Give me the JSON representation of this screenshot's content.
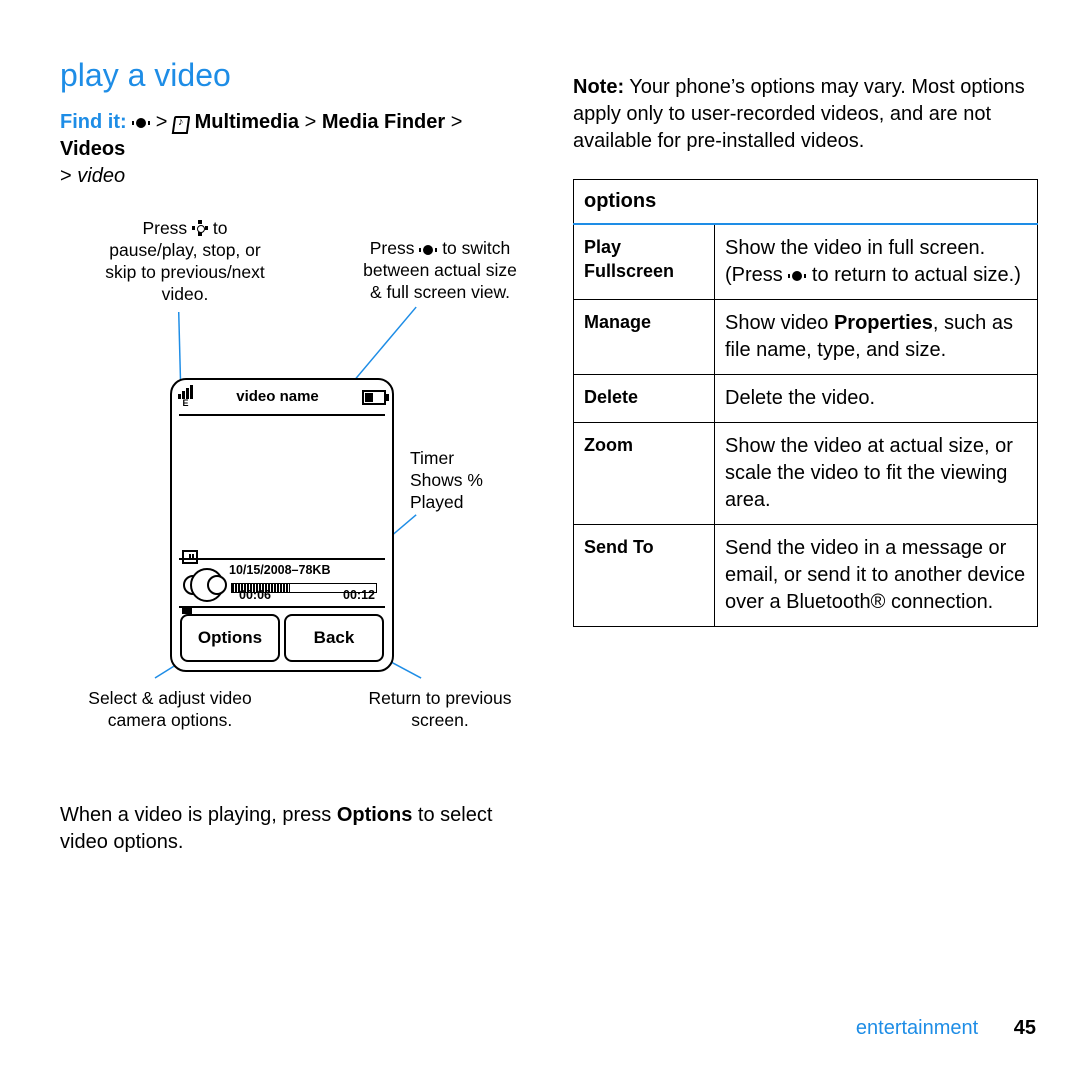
{
  "left": {
    "title": "play a video",
    "findit_label": "Find it:",
    "path_parts": {
      "mm": "Multimedia",
      "mf": "Media Finder",
      "vids": "Videos",
      "video": "video"
    },
    "callouts": {
      "top_left": "Press     to\npause/play, stop, or\nskip to previous/next\nvideo.",
      "top_right": "Press     to switch\nbetween actual size\n& full screen view.",
      "timer": "Timer\nShows %\nPlayed",
      "options": "Select & adjust video\ncamera options.",
      "back": "Return to previous\nscreen."
    },
    "phone": {
      "title": "video   name",
      "meta": "10/15/2008–78KB",
      "t_elapsed": "00:06",
      "t_total": "00:12",
      "sk_left": "Options",
      "sk_right": "Back"
    },
    "para": "When a video is playing, press Options to select video options."
  },
  "right": {
    "note_label": "Note:",
    "note_text": " Your phone’s options may vary. Most options apply only to user-recorded videos, and are not available for pre-installed videos.",
    "table_header": "options",
    "rows": [
      {
        "name": "Play Fullscreen",
        "desc_pre": "Show the video in full screen. (Press ",
        "desc_post": " to return to actual size.)",
        "has_icon": true
      },
      {
        "name": "Manage",
        "desc_pre": "Show video ",
        "bold": "Properties",
        "desc_post": ", such as file name, type, and size."
      },
      {
        "name": "Delete",
        "desc_pre": "Delete the video."
      },
      {
        "name": "Zoom",
        "desc_pre": "Show the video at actual size, or scale the video to fit the viewing area."
      },
      {
        "name": "Send To",
        "desc_pre": "Send the video in a message or email, or send it to another device over a Bluetooth® connection."
      }
    ]
  },
  "footer": {
    "section": "entertainment",
    "page": "45"
  }
}
